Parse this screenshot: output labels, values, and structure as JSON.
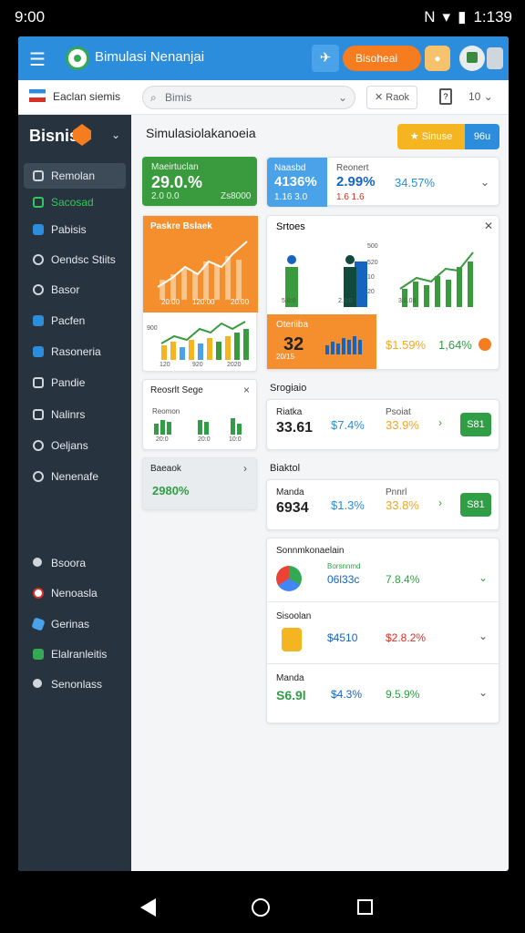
{
  "status": {
    "time": "9:00",
    "battery": "1:139"
  },
  "app": {
    "title": "Bimulasi Nenanjai",
    "pill_label": "Bisoheai",
    "colors": {
      "primary": "#2b8ddb",
      "orange": "#f57c1f",
      "green": "#3a9a3e",
      "sidebar": "#283340"
    }
  },
  "toolbar": {
    "name": "Eaclan siemis",
    "search_placeholder": "Bimis",
    "tool1": "Raok",
    "tool3": "10"
  },
  "sidebar": {
    "brand": "Bisnis",
    "items": [
      {
        "label": "Remolan",
        "icon": "box-icon"
      },
      {
        "label": "Sacosad",
        "icon": "bag-icon"
      },
      {
        "label": "Pabisis",
        "icon": "lock-icon"
      },
      {
        "label": "Oendsc Stiits",
        "icon": "search-icon"
      },
      {
        "label": "Basor",
        "icon": "circle-icon"
      },
      {
        "label": "Pacfen",
        "icon": "folder-icon"
      },
      {
        "label": "Rasoneria",
        "icon": "grid-icon"
      },
      {
        "label": "Pandie",
        "icon": "home-icon"
      },
      {
        "label": "Nalinrs",
        "icon": "table-icon"
      },
      {
        "label": "Oeljans",
        "icon": "info-icon"
      },
      {
        "label": "Nenenafe",
        "icon": "clock-icon"
      },
      {
        "label": "Bsoora",
        "icon": "dot-icon"
      },
      {
        "label": "Nenoasla",
        "icon": "target-icon"
      },
      {
        "label": "Gerinas",
        "icon": "cloud-icon"
      },
      {
        "label": "Elalranleitis",
        "icon": "doc-icon"
      },
      {
        "label": "Senonlass",
        "icon": "users-icon"
      }
    ]
  },
  "main": {
    "title": "Simulasiolakanoeia",
    "badge_yellow": "Sinuse",
    "badge_blue": "96u",
    "kpi_green": {
      "label": "Maeirtuclan",
      "value": "29.0.%",
      "sub1": "2.0 0.0",
      "sub2": "Zs8000"
    },
    "kpi_blue": {
      "label": "Naasbd",
      "value": "4136%",
      "sub": "1.16 3.0"
    },
    "kpi_mid": {
      "label": "Reonert",
      "value": "2.99%",
      "sub": "1.6 1.6"
    },
    "kpi_right": {
      "value": "34.57%"
    },
    "chart1": {
      "title": "Paskre Bslaek",
      "ticks": [
        "20:00",
        "120:00",
        "20:00"
      ]
    },
    "chart2": {
      "ticks": [
        "900",
        "120",
        "920",
        "2020"
      ]
    },
    "stats": {
      "title": "Srtoes",
      "ticks": [
        "5.0:0",
        "2.0:0",
        "3.0.06"
      ],
      "ylabels": [
        "500",
        "520",
        "10",
        "20"
      ]
    },
    "orange_kpi": {
      "label": "Oteriiba",
      "value": "32",
      "sub": "20/15"
    },
    "row_kpi": {
      "v1": "$1.59%",
      "v2": "1,64%"
    },
    "panel_a": {
      "title": "Reosrlt Sege",
      "label": "Reomon",
      "ticks": [
        "20:0",
        "20:0",
        "10:0"
      ]
    },
    "panel_b": {
      "title": "Baeaok",
      "value": "2980%"
    },
    "section1": {
      "title": "Srogiaio",
      "label": "Riatka",
      "value": "33.61",
      "v2": "$7.4%",
      "v3label": "Psoiat",
      "v3": "33.9%",
      "btn": "S81"
    },
    "section2": {
      "title": "Biaktol",
      "label": "Manda",
      "value": "6934",
      "v2": "$1.3%",
      "v3label": "Pnnrl",
      "v3": "33.8%",
      "btn": "S81"
    },
    "list": {
      "title": "Sonnmkonaelain",
      "items": [
        {
          "label": "Borsnnmd",
          "value": "06l33c",
          "pct": "7.8.4%",
          "color": "#2f9e44"
        },
        {
          "label": "Sisoolan",
          "value": "$4510",
          "pct": "$2.8.2%",
          "color": "#d93025"
        },
        {
          "label": "Manda",
          "value": "S6.9l",
          "pct": "9.5.9%",
          "color": "#2f9e44"
        }
      ],
      "item3_v2": "$4.3%"
    }
  }
}
